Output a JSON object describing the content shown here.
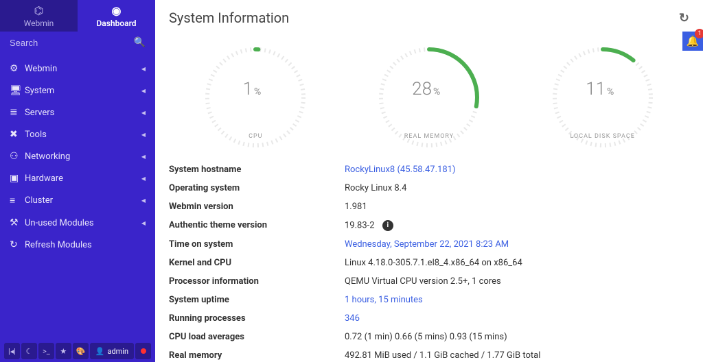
{
  "tabs": {
    "webmin": "Webmin",
    "dashboard": "Dashboard"
  },
  "search": {
    "placeholder": "Search"
  },
  "nav": [
    {
      "icon": "⚙",
      "label": "Webmin"
    },
    {
      "icon": "🖥",
      "label": "System"
    },
    {
      "icon": "≣",
      "label": "Servers"
    },
    {
      "icon": "✖",
      "label": "Tools"
    },
    {
      "icon": "⚇",
      "label": "Networking"
    },
    {
      "icon": "▣",
      "label": "Hardware"
    },
    {
      "icon": "≡",
      "label": "Cluster"
    },
    {
      "icon": "⚒",
      "label": "Un-used Modules"
    },
    {
      "icon": "↻",
      "label": "Refresh Modules"
    }
  ],
  "bottom": {
    "admin": "admin"
  },
  "page_title": "System Information",
  "notifications": {
    "count": "1"
  },
  "gauges": {
    "cpu": {
      "value": "1",
      "unit": "%",
      "label": "CPU",
      "pct": 1
    },
    "mem": {
      "value": "28",
      "unit": "%",
      "label": "REAL MEMORY",
      "pct": 28
    },
    "disk": {
      "value": "11",
      "unit": "%",
      "label": "LOCAL DISK SPACE",
      "pct": 11
    }
  },
  "info": [
    {
      "label": "System hostname",
      "value": "RockyLinux8 (45.58.47.181)",
      "link": true
    },
    {
      "label": "Operating system",
      "value": "Rocky Linux 8.4"
    },
    {
      "label": "Webmin version",
      "value": "1.981"
    },
    {
      "label": "Authentic theme version",
      "value": "19.83-2",
      "badge": true
    },
    {
      "label": "Time on system",
      "value": "Wednesday, September 22, 2021 8:23 AM",
      "link": true
    },
    {
      "label": "Kernel and CPU",
      "value": "Linux 4.18.0-305.7.1.el8_4.x86_64 on x86_64"
    },
    {
      "label": "Processor information",
      "value": "QEMU Virtual CPU version 2.5+, 1 cores"
    },
    {
      "label": "System uptime",
      "value": "1 hours, 15 minutes",
      "link": true
    },
    {
      "label": "Running processes",
      "value": "346",
      "link": true
    },
    {
      "label": "CPU load averages",
      "value": "0.72 (1 min) 0.66 (5 mins) 0.93 (15 mins)"
    },
    {
      "label": "Real memory",
      "value": "492.81 MiB used / 1.1 GiB cached / 1.77 GiB total"
    }
  ]
}
